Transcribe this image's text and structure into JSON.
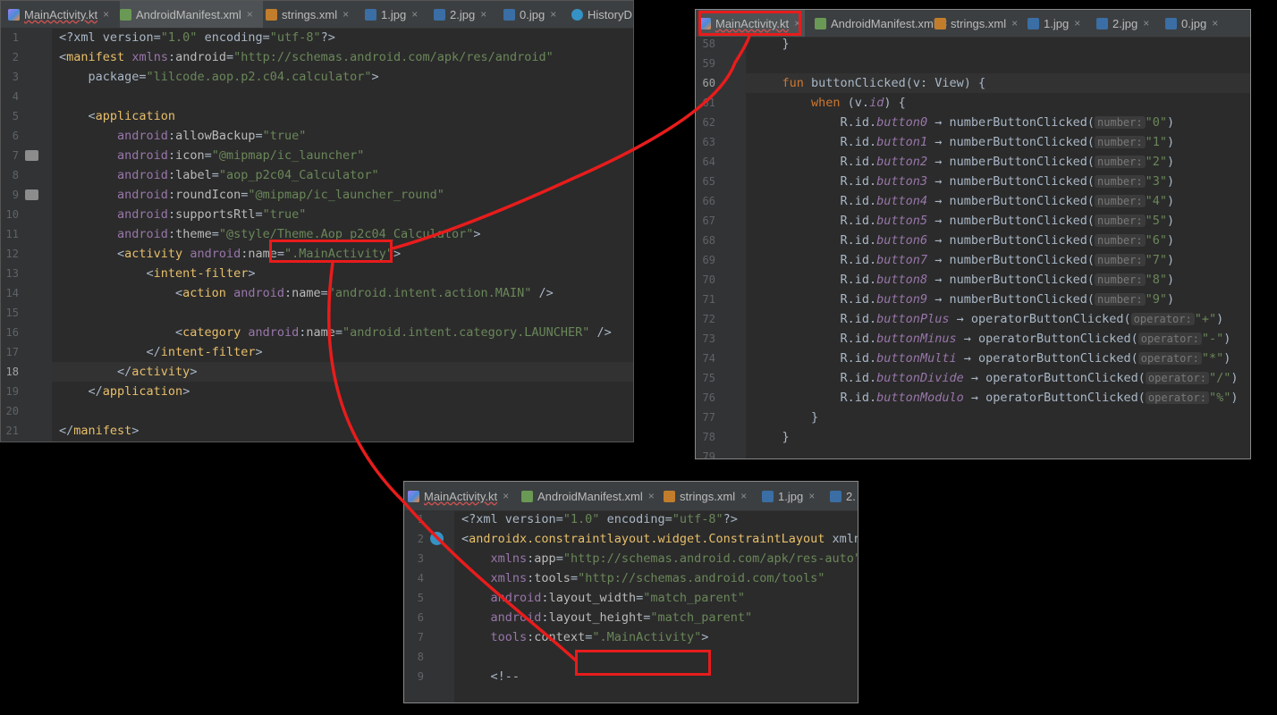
{
  "panels": {
    "manifest": {
      "tabs": [
        {
          "label": "MainActivity.kt",
          "close": "×"
        },
        {
          "label": "AndroidManifest.xml",
          "close": "×"
        },
        {
          "label": "strings.xml",
          "close": "×"
        },
        {
          "label": "1.jpg",
          "close": "×"
        },
        {
          "label": "2.jpg",
          "close": "×"
        },
        {
          "label": "0.jpg",
          "close": "×"
        },
        {
          "label": "HistoryD"
        }
      ],
      "lines": [
        {
          "n": "1",
          "t": "<?xml version=\"1.0\" encoding=\"utf-8\"?>"
        },
        {
          "n": "2",
          "t": "<manifest xmlns:android=\"http://schemas.android.com/apk/res/android\""
        },
        {
          "n": "3",
          "t": "    package=\"lilcode.aop.p2.c04.calculator\">"
        },
        {
          "n": "4",
          "t": ""
        },
        {
          "n": "5",
          "t": "    <application"
        },
        {
          "n": "6",
          "t": "        android:allowBackup=\"true\""
        },
        {
          "n": "7",
          "t": "        android:icon=\"@mipmap/ic_launcher\""
        },
        {
          "n": "8",
          "t": "        android:label=\"aop_p2c04_Calculator\""
        },
        {
          "n": "9",
          "t": "        android:roundIcon=\"@mipmap/ic_launcher_round\""
        },
        {
          "n": "10",
          "t": "        android:supportsRtl=\"true\""
        },
        {
          "n": "11",
          "t": "        android:theme=\"@style/Theme.Aop_p2c04_Calculator\">"
        },
        {
          "n": "12",
          "t": "        <activity android:name=\".MainActivity\">"
        },
        {
          "n": "13",
          "t": "            <intent-filter>"
        },
        {
          "n": "14",
          "t": "                <action android:name=\"android.intent.action.MAIN\" />"
        },
        {
          "n": "15",
          "t": ""
        },
        {
          "n": "16",
          "t": "                <category android:name=\"android.intent.category.LAUNCHER\" />"
        },
        {
          "n": "17",
          "t": "            </intent-filter>"
        },
        {
          "n": "18",
          "t": "        </activity>"
        },
        {
          "n": "19",
          "t": "    </application>"
        },
        {
          "n": "20",
          "t": ""
        },
        {
          "n": "21",
          "t": "</manifest>"
        }
      ],
      "current_line": "18"
    },
    "kotlin": {
      "tabs": [
        {
          "label": "MainActivity.kt",
          "close": "×"
        },
        {
          "label": "AndroidManifest.xml",
          "close": "×"
        },
        {
          "label": "strings.xml",
          "close": "×"
        },
        {
          "label": "1.jpg",
          "close": "×"
        },
        {
          "label": "2.jpg",
          "close": "×"
        },
        {
          "label": "0.jpg",
          "close": "×"
        }
      ],
      "lines": [
        {
          "n": "58",
          "t": "    }"
        },
        {
          "n": "59",
          "t": ""
        },
        {
          "n": "60",
          "t": "    fun buttonClicked(v: View) {"
        },
        {
          "n": "61",
          "t": "        when (v.id) {"
        },
        {
          "n": "62",
          "t": "            R.id.button0 → numberButtonClicked( number: \"0\")"
        },
        {
          "n": "63",
          "t": "            R.id.button1 → numberButtonClicked( number: \"1\")"
        },
        {
          "n": "64",
          "t": "            R.id.button2 → numberButtonClicked( number: \"2\")"
        },
        {
          "n": "65",
          "t": "            R.id.button3 → numberButtonClicked( number: \"3\")"
        },
        {
          "n": "66",
          "t": "            R.id.button4 → numberButtonClicked( number: \"4\")"
        },
        {
          "n": "67",
          "t": "            R.id.button5 → numberButtonClicked( number: \"5\")"
        },
        {
          "n": "68",
          "t": "            R.id.button6 → numberButtonClicked( number: \"6\")"
        },
        {
          "n": "69",
          "t": "            R.id.button7 → numberButtonClicked( number: \"7\")"
        },
        {
          "n": "70",
          "t": "            R.id.button8 → numberButtonClicked( number: \"8\")"
        },
        {
          "n": "71",
          "t": "            R.id.button9 → numberButtonClicked( number: \"9\")"
        },
        {
          "n": "72",
          "t": "            R.id.buttonPlus → operatorButtonClicked( operator: \"+\")"
        },
        {
          "n": "73",
          "t": "            R.id.buttonMinus → operatorButtonClicked( operator: \"-\")"
        },
        {
          "n": "74",
          "t": "            R.id.buttonMulti → operatorButtonClicked( operator: \"*\")"
        },
        {
          "n": "75",
          "t": "            R.id.buttonDivide → operatorButtonClicked( operator: \"/\")"
        },
        {
          "n": "76",
          "t": "            R.id.buttonModulo → operatorButtonClicked( operator: \"%\")"
        },
        {
          "n": "77",
          "t": "        }"
        },
        {
          "n": "78",
          "t": "    }"
        },
        {
          "n": "79",
          "t": ""
        }
      ],
      "current_line": "60"
    },
    "layout": {
      "tabs": [
        {
          "label": "MainActivity.kt",
          "close": "×"
        },
        {
          "label": "AndroidManifest.xml",
          "close": "×"
        },
        {
          "label": "strings.xml",
          "close": "×"
        },
        {
          "label": "1.jpg",
          "close": "×"
        },
        {
          "label": "2."
        }
      ],
      "lines": [
        {
          "n": "1",
          "t": "<?xml version=\"1.0\" encoding=\"utf-8\"?>"
        },
        {
          "n": "2",
          "t": "<androidx.constraintlayout.widget.ConstraintLayout xmlns:"
        },
        {
          "n": "3",
          "t": "    xmlns:app=\"http://schemas.android.com/apk/res-auto\""
        },
        {
          "n": "4",
          "t": "    xmlns:tools=\"http://schemas.android.com/tools\""
        },
        {
          "n": "5",
          "t": "    android:layout_width=\"match_parent\""
        },
        {
          "n": "6",
          "t": "    android:layout_height=\"match_parent\""
        },
        {
          "n": "7",
          "t": "    tools:context=\".MainActivity\">"
        },
        {
          "n": "8",
          "t": ""
        },
        {
          "n": "9",
          "t": "    <!--"
        }
      ]
    }
  },
  "colors": {
    "highlight": "#e81c1c",
    "editor_bg": "#2b2b2b",
    "gutter_bg": "#313335"
  }
}
